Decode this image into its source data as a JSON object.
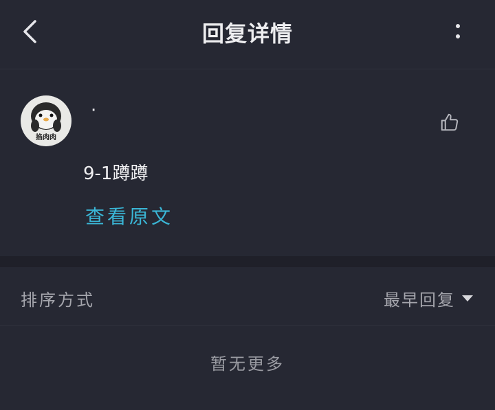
{
  "header": {
    "title": "回复详情",
    "back_icon": "chevron-left-icon",
    "more_icon": "more-vertical-icon"
  },
  "comment": {
    "avatar_caption": "掐肉肉",
    "username": "·",
    "text": "9-1蹲蹲",
    "view_original": "查看原文",
    "like_icon": "thumbs-up-icon"
  },
  "sort": {
    "label": "排序方式",
    "value": "最早回复"
  },
  "footer": {
    "no_more": "暂无更多"
  },
  "colors": {
    "background": "#262833",
    "accent": "#3ab6d6",
    "divider": "#1f2029"
  }
}
